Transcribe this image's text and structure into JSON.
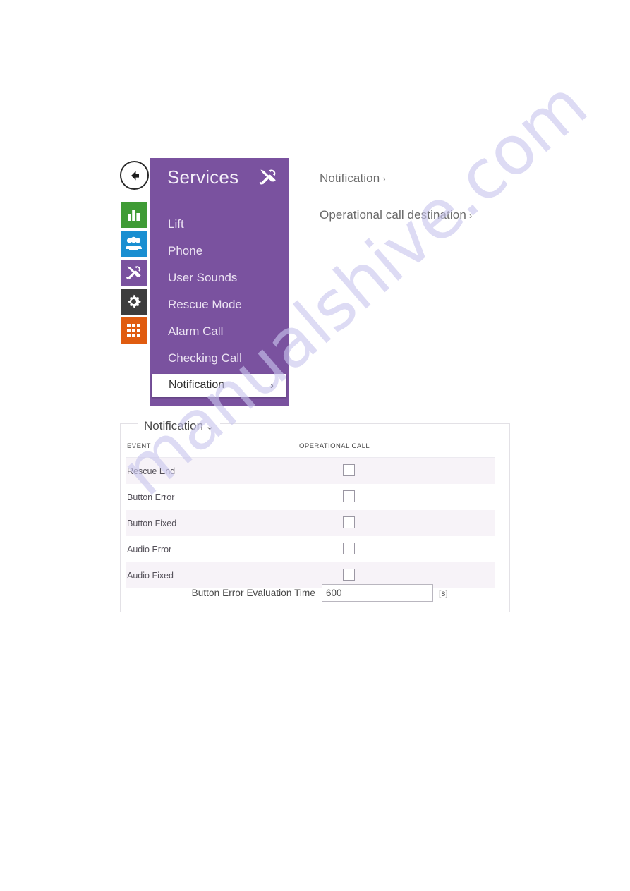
{
  "watermark": {
    "text": "manualshive.com"
  },
  "nav": {
    "back_icon": "back-arrow-icon",
    "rail_items": [
      {
        "name": "statistics",
        "icon": "bar-chart-icon",
        "color": "#3f9b35"
      },
      {
        "name": "directory",
        "icon": "people-icon",
        "color": "#1a8fd1"
      },
      {
        "name": "services",
        "icon": "tools-icon",
        "color": "#7a529f"
      },
      {
        "name": "system",
        "icon": "gear-icon",
        "color": "#3d3d3d"
      },
      {
        "name": "apps",
        "icon": "grid-icon",
        "color": "#e05c10"
      }
    ]
  },
  "services_menu": {
    "title": "Services",
    "header_icon": "tools-icon",
    "accent_color": "#7a529f",
    "items": [
      {
        "label": "Lift",
        "selected": false
      },
      {
        "label": "Phone",
        "selected": false
      },
      {
        "label": "User Sounds",
        "selected": false
      },
      {
        "label": "Rescue Mode",
        "selected": false
      },
      {
        "label": "Alarm Call",
        "selected": false
      },
      {
        "label": "Checking Call",
        "selected": false
      }
    ],
    "selected_item": {
      "label": "Notification",
      "chevron": "›"
    }
  },
  "side_links": [
    {
      "label": "Notification",
      "chevron": "›"
    },
    {
      "label": "Operational call destination",
      "chevron": "›"
    }
  ],
  "panel": {
    "title": "Notification",
    "collapse_chevron": "⌄",
    "table": {
      "headers": [
        "EVENT",
        "OPERATIONAL CALL"
      ],
      "rows": [
        {
          "event": "Rescue End",
          "operational_call": false
        },
        {
          "event": "Button Error",
          "operational_call": false
        },
        {
          "event": "Button Fixed",
          "operational_call": false
        },
        {
          "event": "Audio Error",
          "operational_call": false
        },
        {
          "event": "Audio Fixed",
          "operational_call": false
        }
      ]
    },
    "eval_time": {
      "label": "Button Error Evaluation Time",
      "value": "600",
      "placeholder": "",
      "unit": "[s]"
    }
  }
}
